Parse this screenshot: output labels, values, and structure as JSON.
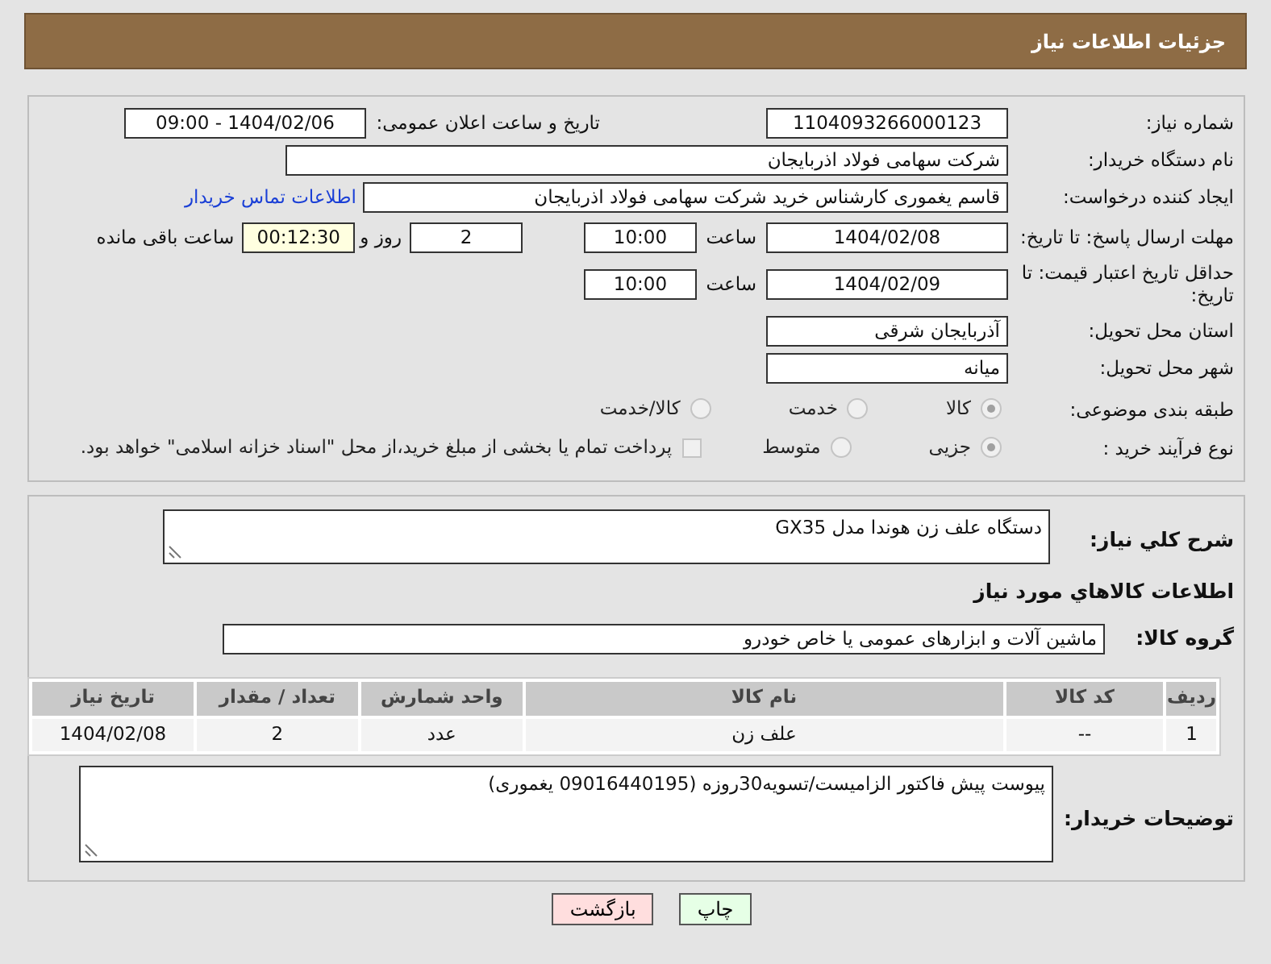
{
  "header": {
    "title": "جزئیات اطلاعات نیاز"
  },
  "need_number": {
    "label": "شماره نیاز:",
    "value": "1104093266000123"
  },
  "announce": {
    "label": "تاریخ و ساعت اعلان عمومی:",
    "value": "1404/02/06 - 09:00"
  },
  "buyer_org": {
    "label": "نام دستگاه خریدار:",
    "value": "شرکت سهامی فولاد اذربایجان"
  },
  "requester": {
    "label": "ایجاد کننده درخواست:",
    "value": "قاسم یغموری کارشناس خرید شرکت سهامی فولاد اذربایجان",
    "link": "اطلاعات تماس خریدار"
  },
  "reply_deadline": {
    "label": "مهلت ارسال پاسخ: تا تاریخ:",
    "date": "1404/02/08",
    "time_label": "ساعت",
    "time": "10:00",
    "days": "2",
    "days_label": "روز و",
    "remaining": "00:12:30",
    "remaining_label": "ساعت باقی مانده"
  },
  "price_validity": {
    "label": "حداقل تاریخ اعتبار قیمت: تا تاریخ:",
    "date": "1404/02/09",
    "time_label": "ساعت",
    "time": "10:00"
  },
  "province": {
    "label": "استان محل تحویل:",
    "value": "آذربایجان شرقی"
  },
  "city": {
    "label": "شهر محل تحویل:",
    "value": "میانه"
  },
  "category": {
    "label": "طبقه بندی موضوعی:",
    "options": [
      {
        "label": "کالا",
        "selected": true
      },
      {
        "label": "خدمت",
        "selected": false
      },
      {
        "label": "کالا/خدمت",
        "selected": false
      }
    ]
  },
  "process": {
    "label": "نوع فرآیند خرید :",
    "options": [
      {
        "label": "جزیی",
        "selected": true
      },
      {
        "label": "متوسط",
        "selected": false
      }
    ],
    "treasury": {
      "label": "پرداخت تمام یا بخشی از مبلغ خرید،از محل \"اسناد خزانه اسلامی\" خواهد بود.",
      "checked": false
    }
  },
  "description": {
    "label": "شرح کلي نياز:",
    "value": "دستگاه علف زن هوندا مدل GX35"
  },
  "goods_heading": "اطلاعات کالاهاي مورد نياز",
  "goods_group": {
    "label": "گروه کالا:",
    "value": "ماشین آلات و ابزارهای عمومی یا خاص خودرو"
  },
  "table": {
    "columns": [
      "ردیف",
      "کد کالا",
      "نام کالا",
      "واحد شمارش",
      "تعداد / مقدار",
      "تاریخ نیاز"
    ],
    "rows": [
      [
        "1",
        "--",
        "علف زن",
        "عدد",
        "2",
        "1404/02/08"
      ]
    ]
  },
  "buyer_notes": {
    "label": "توضیحات خریدار:",
    "value": "پیوست پیش فاکتور الزامیست/تسویه30روزه (09016440195 یغموری)"
  },
  "buttons": [
    {
      "label": "چاپ",
      "kind": "print"
    },
    {
      "label": "بازگشت",
      "kind": "back"
    }
  ]
}
